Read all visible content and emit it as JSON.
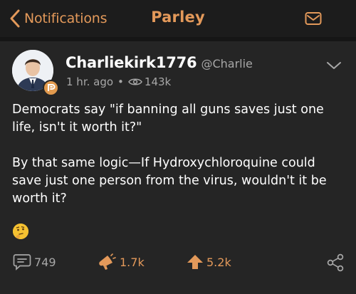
{
  "nav": {
    "back_label": "Notifications",
    "title": "Parley",
    "icons": {
      "back": "chevron-left-icon",
      "mail": "envelope-icon"
    }
  },
  "post": {
    "display_name": "Charliekirk1776",
    "handle": "@Charlie",
    "time": "1 hr. ago",
    "separator": "•",
    "views": "143k",
    "paragraphs": [
      "Democrats say \"if banning all guns saves just one life, isn't it worth it?\"",
      "By that same logic—If Hydroxychloroquine could save just one person from the virus, wouldn't it be worth it?"
    ],
    "emoji": "thinking-face-emoji",
    "menu_icon": "chevron-down-icon"
  },
  "actions": {
    "comments": "749",
    "echoes": "1.7k",
    "upvotes": "5.2k",
    "icons": {
      "comments": "comment-icon",
      "echoes": "megaphone-icon",
      "upvotes": "upvote-arrow-icon",
      "share": "share-icon"
    }
  },
  "colors": {
    "accent": "#e3995a",
    "background": "#161616",
    "card": "#252525",
    "secondary_text": "#a7a7a7"
  }
}
